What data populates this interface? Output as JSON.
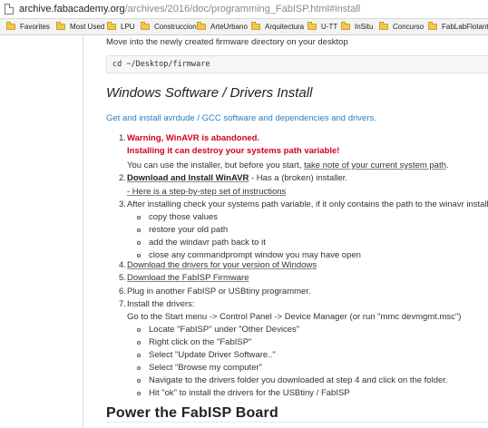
{
  "browser": {
    "url_host": "archive.fabacademy.org",
    "url_path": "/archives/2016/doc/programming_FabISP.html#install",
    "bookmarks": [
      "Favorites",
      "Most Used",
      "LPU",
      "Construccion",
      "ArteUrbano",
      "Arquitectura",
      "U-TT",
      "InSitu",
      "Concurso",
      "FabLabFlotante"
    ]
  },
  "page": {
    "intro": "Move into the newly created firmware directory on your desktop",
    "code": "cd ~/Desktop/firmware",
    "section_title": "Windows Software / Drivers Install",
    "link_text": "Get and install avrdude / GCC software and dependencies and drivers.",
    "steps": {
      "s1_num": "1.",
      "s1_warn1": "Warning, WinAVR is abandoned.",
      "s1_warn2": "Installing it can destroy your systems path variable!",
      "s1_text_a": "You can use the installer, but before you start, ",
      "s1_text_b": "take note of your current system path",
      "s1_text_c": ".",
      "s2_num": "2.",
      "s2_bold": "Download and Install WinAVR",
      "s2_text": " - Has a (broken) installer.",
      "s2_sub": "- Here is a step-by-step set of instructions",
      "s3_num": "3.",
      "s3_text": "After installing check your systems path variable, if it only contains the path to the winavr installation:",
      "s3_bullets": [
        "copy those values",
        "restore your old path",
        "add the windavr path back to it",
        "close any commandprompt window you may have open"
      ],
      "s4_num": "4.",
      "s4_text": "Download the drivers for your version of Windows",
      "s5_num": "5.",
      "s5_text": "Download the FabISP Firmware",
      "s6_num": "6.",
      "s6_text": "Plug in another FabISP or USBtiny programmer.",
      "s7_num": "7.",
      "s7_text": "Install the drivers:",
      "s7_sub": "Go to the Start menu -> Control Panel -> Device Manager (or run \"mmc devmgmt.msc\")",
      "s7_bullets": [
        "Locate \"FabISP\" under \"Other Devices\"",
        "Right click on the \"FabISP\"",
        "Select \"Update Driver Software..\"",
        "Select \"Browse my computer\"",
        "Navigate to the drivers folder you downloaded at step 4 and click on the folder.",
        "Hit \"ok\" to install the drivers for the USBtiny / FabISP"
      ]
    },
    "next_title": "Power the FabISP Board"
  }
}
